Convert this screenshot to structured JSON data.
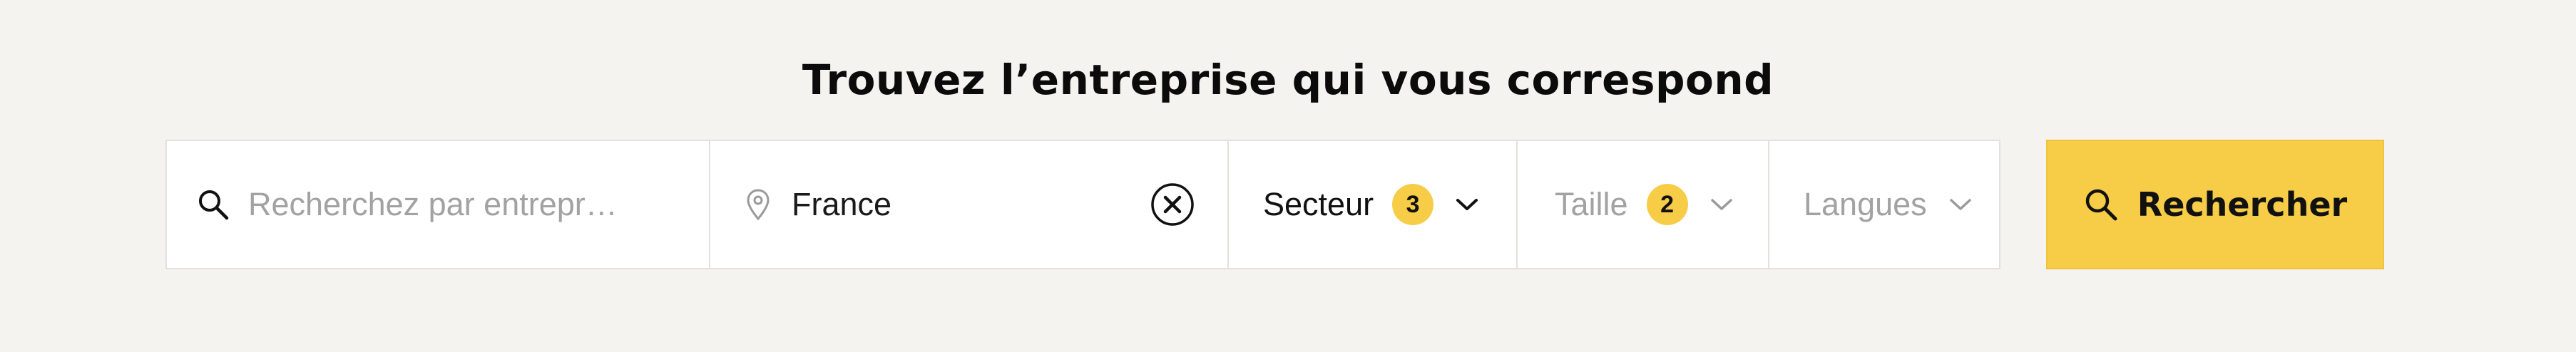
{
  "heading": "Trouvez l’entreprise qui vous correspond",
  "search": {
    "placeholder": "Recherchez par entrepr…",
    "icon": "search-icon"
  },
  "location": {
    "value": "France",
    "icon": "location-pin-icon",
    "clear_icon": "clear-circle-icon"
  },
  "filters": [
    {
      "label": "Secteur",
      "count": "3",
      "active": true
    },
    {
      "label": "Taille",
      "count": "2",
      "active": false
    },
    {
      "label": "Langues",
      "count": null,
      "active": false
    }
  ],
  "submit": {
    "label": "Rechercher",
    "icon": "search-icon"
  },
  "colors": {
    "accent": "#f7cd47",
    "background": "#f4f3f0",
    "muted_text": "#a2a2a2",
    "text": "#111111"
  }
}
